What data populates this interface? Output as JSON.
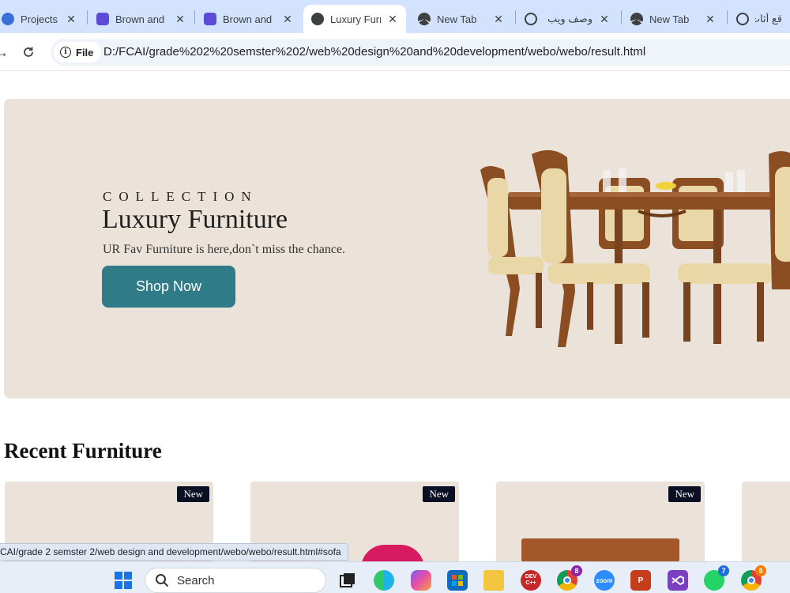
{
  "browser": {
    "tabs": [
      {
        "title": "Projects - (",
        "icon": "globe-icon"
      },
      {
        "title": "Brown and",
        "icon": "app-icon"
      },
      {
        "title": "Brown and",
        "icon": "app-icon"
      },
      {
        "title": "Luxury Furn",
        "icon": "globe-icon",
        "active": true
      },
      {
        "title": "New Tab",
        "icon": "chrome-icon"
      },
      {
        "title": "وصف ويب",
        "icon": "openai-icon"
      },
      {
        "title": "New Tab",
        "icon": "chrome-icon"
      },
      {
        "title": "قع أثاث",
        "icon": "openai-icon"
      }
    ],
    "close_glyph": "✕",
    "site_chip": "File",
    "url": "D:/FCAI/grade%202%20semster%202/web%20design%20and%20development/webo/webo/result.html"
  },
  "hero": {
    "eyebrow": "COLLECTION",
    "title": "Luxury Furniture",
    "subtitle": "UR Fav Furniture is here,don`t miss the chance.",
    "button": "Shop Now",
    "image_icon": "dining-set-image"
  },
  "recent": {
    "title": "Recent Furniture",
    "badge": "New"
  },
  "status_url": "CAI/grade 2 semster 2/web design and development/webo/webo/result.html#sofa",
  "taskbar": {
    "search_label": "Search",
    "chrome_badge_count": "8",
    "whatsapp_badge_count": "7",
    "chrome2_badge_count": "5",
    "devcpp_label": "DEV C++",
    "zoom_label": "zoom"
  },
  "colors": {
    "hero_bg": "#ebe2da",
    "accent_button": "#2f7b88",
    "badge_bg": "#0b0f24",
    "tabstrip": "#d3e3fd"
  }
}
